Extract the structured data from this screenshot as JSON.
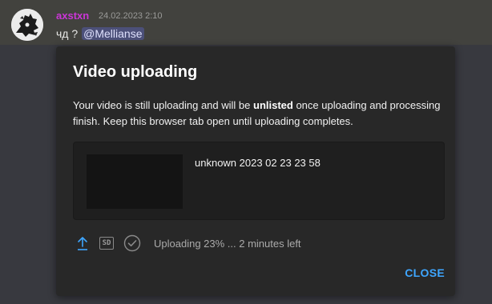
{
  "chat": {
    "author": "axstxn",
    "timestamp": "24.02.2023 2:10",
    "message_text": "чд ?",
    "mention": "@Mellianse",
    "author_color": "#cc36d8"
  },
  "dialog": {
    "title": "Video uploading",
    "description_before": "Your video is still uploading and will be ",
    "description_emphasis": "unlisted",
    "description_after": " once uploading and processing finish. Keep this browser tab open until uploading completes.",
    "video_title": "unknown 2023 02 23 23 58",
    "icons": [
      "upload-icon",
      "sd-icon",
      "check-circle-icon"
    ],
    "sd_label": "SD",
    "status_text": "Uploading 23% ... 2 minutes left",
    "upload_progress_percent": 23,
    "close_label": "CLOSE",
    "accent_color": "#3ea6ff"
  }
}
